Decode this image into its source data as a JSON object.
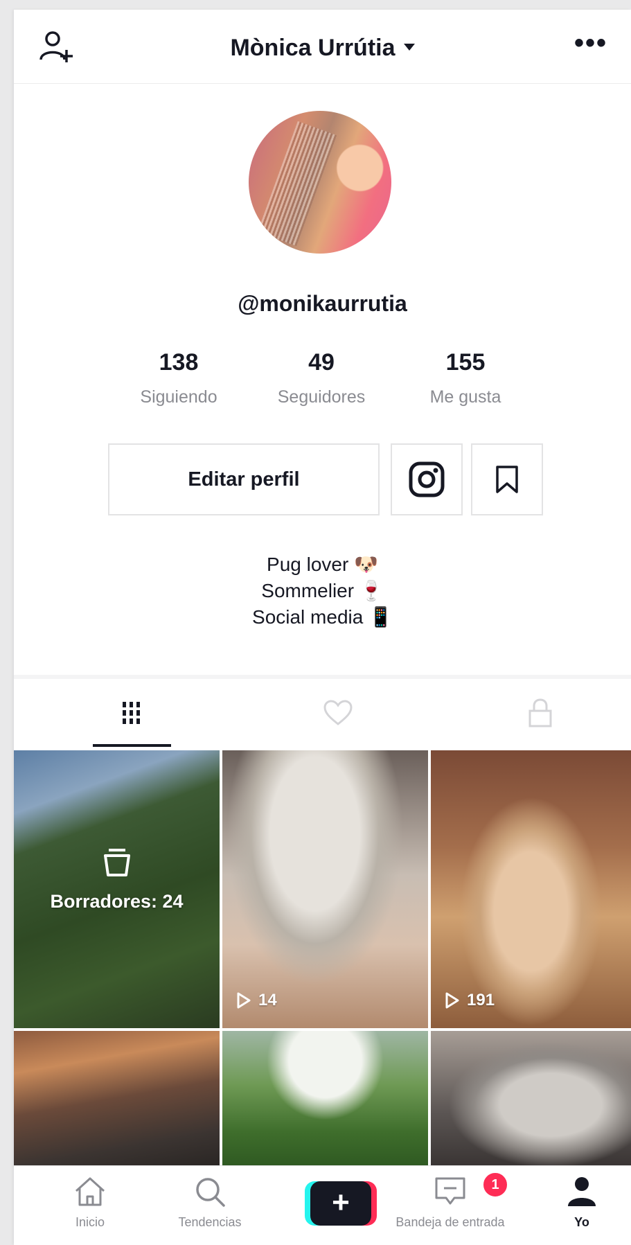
{
  "header": {
    "title": "Mònica Urrútia",
    "more_label": "•••"
  },
  "profile": {
    "handle": "@monikaurrutia",
    "stats": [
      {
        "value": "138",
        "label": "Siguiendo"
      },
      {
        "value": "49",
        "label": "Seguidores"
      },
      {
        "value": "155",
        "label": "Me gusta"
      }
    ],
    "edit_label": "Editar perfil",
    "bio": [
      "Pug lover 🐶",
      "Sommelier 🍷",
      "Social media 📱"
    ]
  },
  "tabs": [
    {
      "icon": "grid-icon",
      "active": true
    },
    {
      "icon": "heart-icon",
      "active": false
    },
    {
      "icon": "lock-icon",
      "active": false
    }
  ],
  "grid": {
    "drafts_label": "Borradores: 24",
    "videos": [
      {
        "views": "14"
      },
      {
        "views": "191"
      }
    ]
  },
  "bottom_nav": {
    "items": [
      {
        "label": "Inicio",
        "icon": "home-icon"
      },
      {
        "label": "Tendencias",
        "icon": "search-icon"
      },
      {
        "label": "",
        "icon": "plus-icon"
      },
      {
        "label": "Bandeja de entrada",
        "icon": "inbox-icon"
      },
      {
        "label": "Yo",
        "icon": "person-icon"
      }
    ],
    "create_label": "+",
    "inbox_badge": "1"
  },
  "colors": {
    "text": "#161823",
    "muted": "#8a8b91",
    "accent_pink": "#fe2c55",
    "accent_cyan": "#25f4ee",
    "border": "#e3e3e4"
  }
}
